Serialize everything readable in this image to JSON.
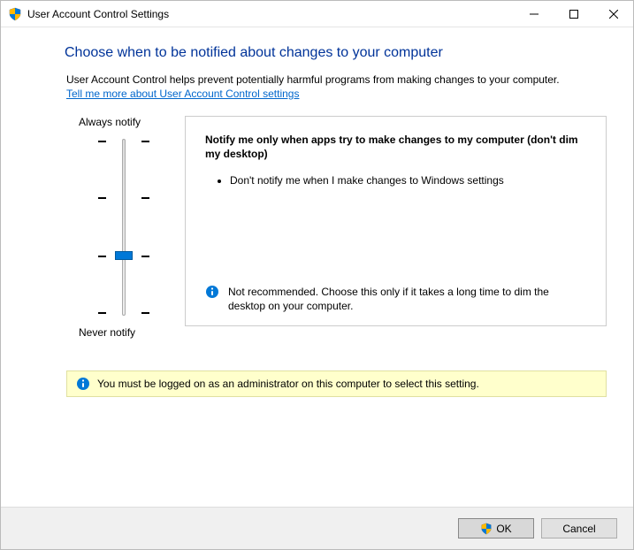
{
  "window": {
    "title": "User Account Control Settings"
  },
  "content": {
    "heading": "Choose when to be notified about changes to your computer",
    "description": "User Account Control helps prevent potentially harmful programs from making changes to your computer.",
    "link": "Tell me more about User Account Control settings"
  },
  "slider": {
    "top_label": "Always notify",
    "bottom_label": "Never notify",
    "levels": 4,
    "selected_index": 2
  },
  "panel": {
    "title": "Notify me only when apps try to make changes to my computer (don't dim my desktop)",
    "bullets": [
      "Don't notify me when I make changes to Windows settings"
    ],
    "note": "Not recommended. Choose this only if it takes a long time to dim the desktop on your computer."
  },
  "banner": {
    "text": "You must be logged on as an administrator on this computer to select this setting."
  },
  "buttons": {
    "ok": "OK",
    "cancel": "Cancel"
  },
  "icons": {
    "shield": "shield-icon",
    "minimize": "—",
    "maximize": "☐",
    "close": "✕",
    "info": "info-icon"
  }
}
